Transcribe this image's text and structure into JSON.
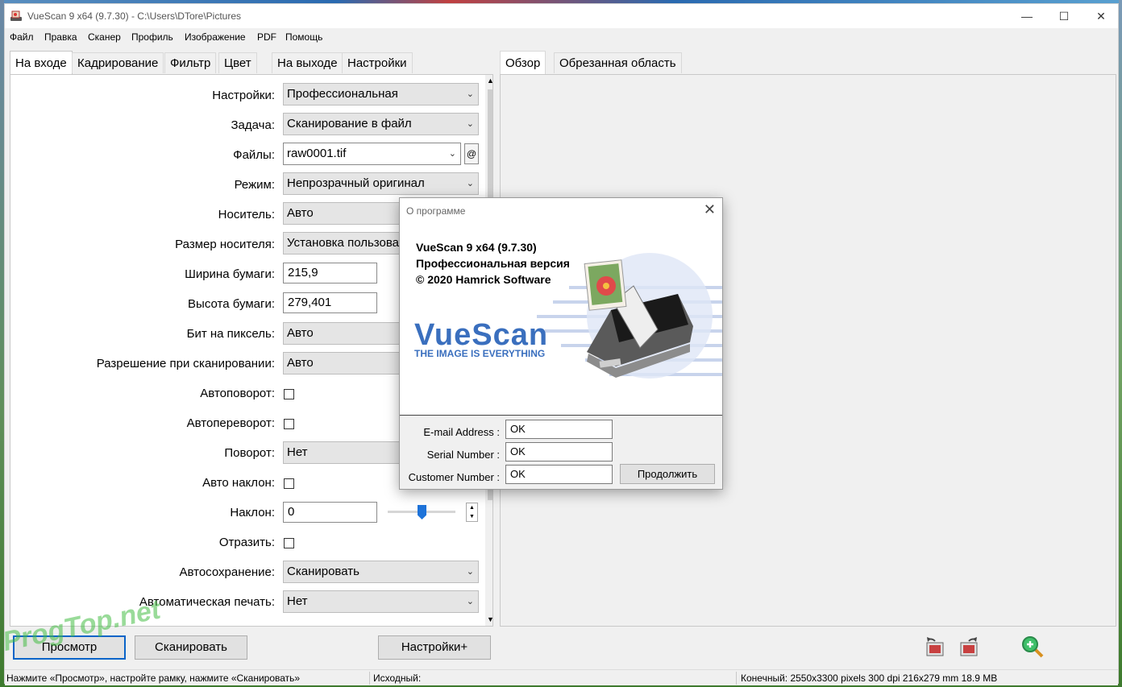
{
  "window": {
    "title": "VueScan 9 x64 (9.7.30) - C:\\Users\\DTore\\Pictures",
    "minimize": "—",
    "maximize": "☐",
    "close": "✕"
  },
  "menu": [
    "Файл",
    "Правка",
    "Сканер",
    "Профиль",
    "Изображение",
    "PDF",
    "Помощь"
  ],
  "left_tabs": [
    "На входе",
    "Кадрирование",
    "Фильтр",
    "Цвет",
    "На выходе",
    "Настройки"
  ],
  "right_tabs": [
    "Обзор",
    "Обрезанная область"
  ],
  "form": {
    "settings": {
      "label": "Настройки:",
      "value": "Профессиональная"
    },
    "task": {
      "label": "Задача:",
      "value": "Сканирование в файл"
    },
    "files": {
      "label": "Файлы:",
      "value": "raw0001.tif",
      "at": "@"
    },
    "mode": {
      "label": "Режим:",
      "value": "Непрозрачный оригинал"
    },
    "media": {
      "label": "Носитель:",
      "value": "Авто"
    },
    "media_size": {
      "label": "Размер носителя:",
      "value": "Установка пользоват"
    },
    "paper_width": {
      "label": "Ширина бумаги:",
      "value": "215,9"
    },
    "paper_height": {
      "label": "Высота бумаги:",
      "value": "279,401"
    },
    "bits": {
      "label": "Бит на пиксель:",
      "value": "Авто"
    },
    "resolution": {
      "label": "Разрешение при сканировании:",
      "value": "Авто"
    },
    "auto_rotate": {
      "label": "Автоповорот:"
    },
    "auto_flip": {
      "label": "Автопереворот:"
    },
    "rotation": {
      "label": "Поворот:",
      "value": "Нет"
    },
    "auto_skew": {
      "label": "Авто наклон:"
    },
    "skew": {
      "label": "Наклон:",
      "value": "0"
    },
    "mirror": {
      "label": "Отразить:"
    },
    "autosave": {
      "label": "Автосохранение:",
      "value": "Сканировать"
    },
    "autoprint": {
      "label": "Автоматическая печать:",
      "value": "Нет"
    },
    "skew_level": 0.5
  },
  "buttons": {
    "preview": "Просмотр",
    "scan": "Сканировать",
    "more": "Настройки+"
  },
  "toolbar_icons": [
    "rotate-left-icon",
    "rotate-right-icon",
    "zoom-in-icon"
  ],
  "status": {
    "hint": "Нажмите «Просмотр», настройте рамку, нажмите «Сканировать»",
    "source": "Исходный:",
    "output": "Конечный: 2550x3300 pixels 300 dpi 216x279 mm 18.9 MB"
  },
  "dialog": {
    "title": "О программе",
    "close": "✕",
    "line1": "VueScan 9 x64 (9.7.30)",
    "line2": "Профессиональная версия",
    "line3": "© 2020 Hamrick Software",
    "logo": "VueScan",
    "tagline": "THE IMAGE IS EVERYTHING",
    "email_label": "E-mail Address :",
    "email_value": "OK",
    "serial_label": "Serial Number :",
    "serial_value": "OK",
    "customer_label": "Customer Number :",
    "customer_value": "OK",
    "continue": "Продолжить"
  },
  "watermark": "ProgTop.net",
  "colors": {
    "accent": "#0a64c8",
    "logo": "#3a6fbe",
    "watermark": "#46be46"
  }
}
